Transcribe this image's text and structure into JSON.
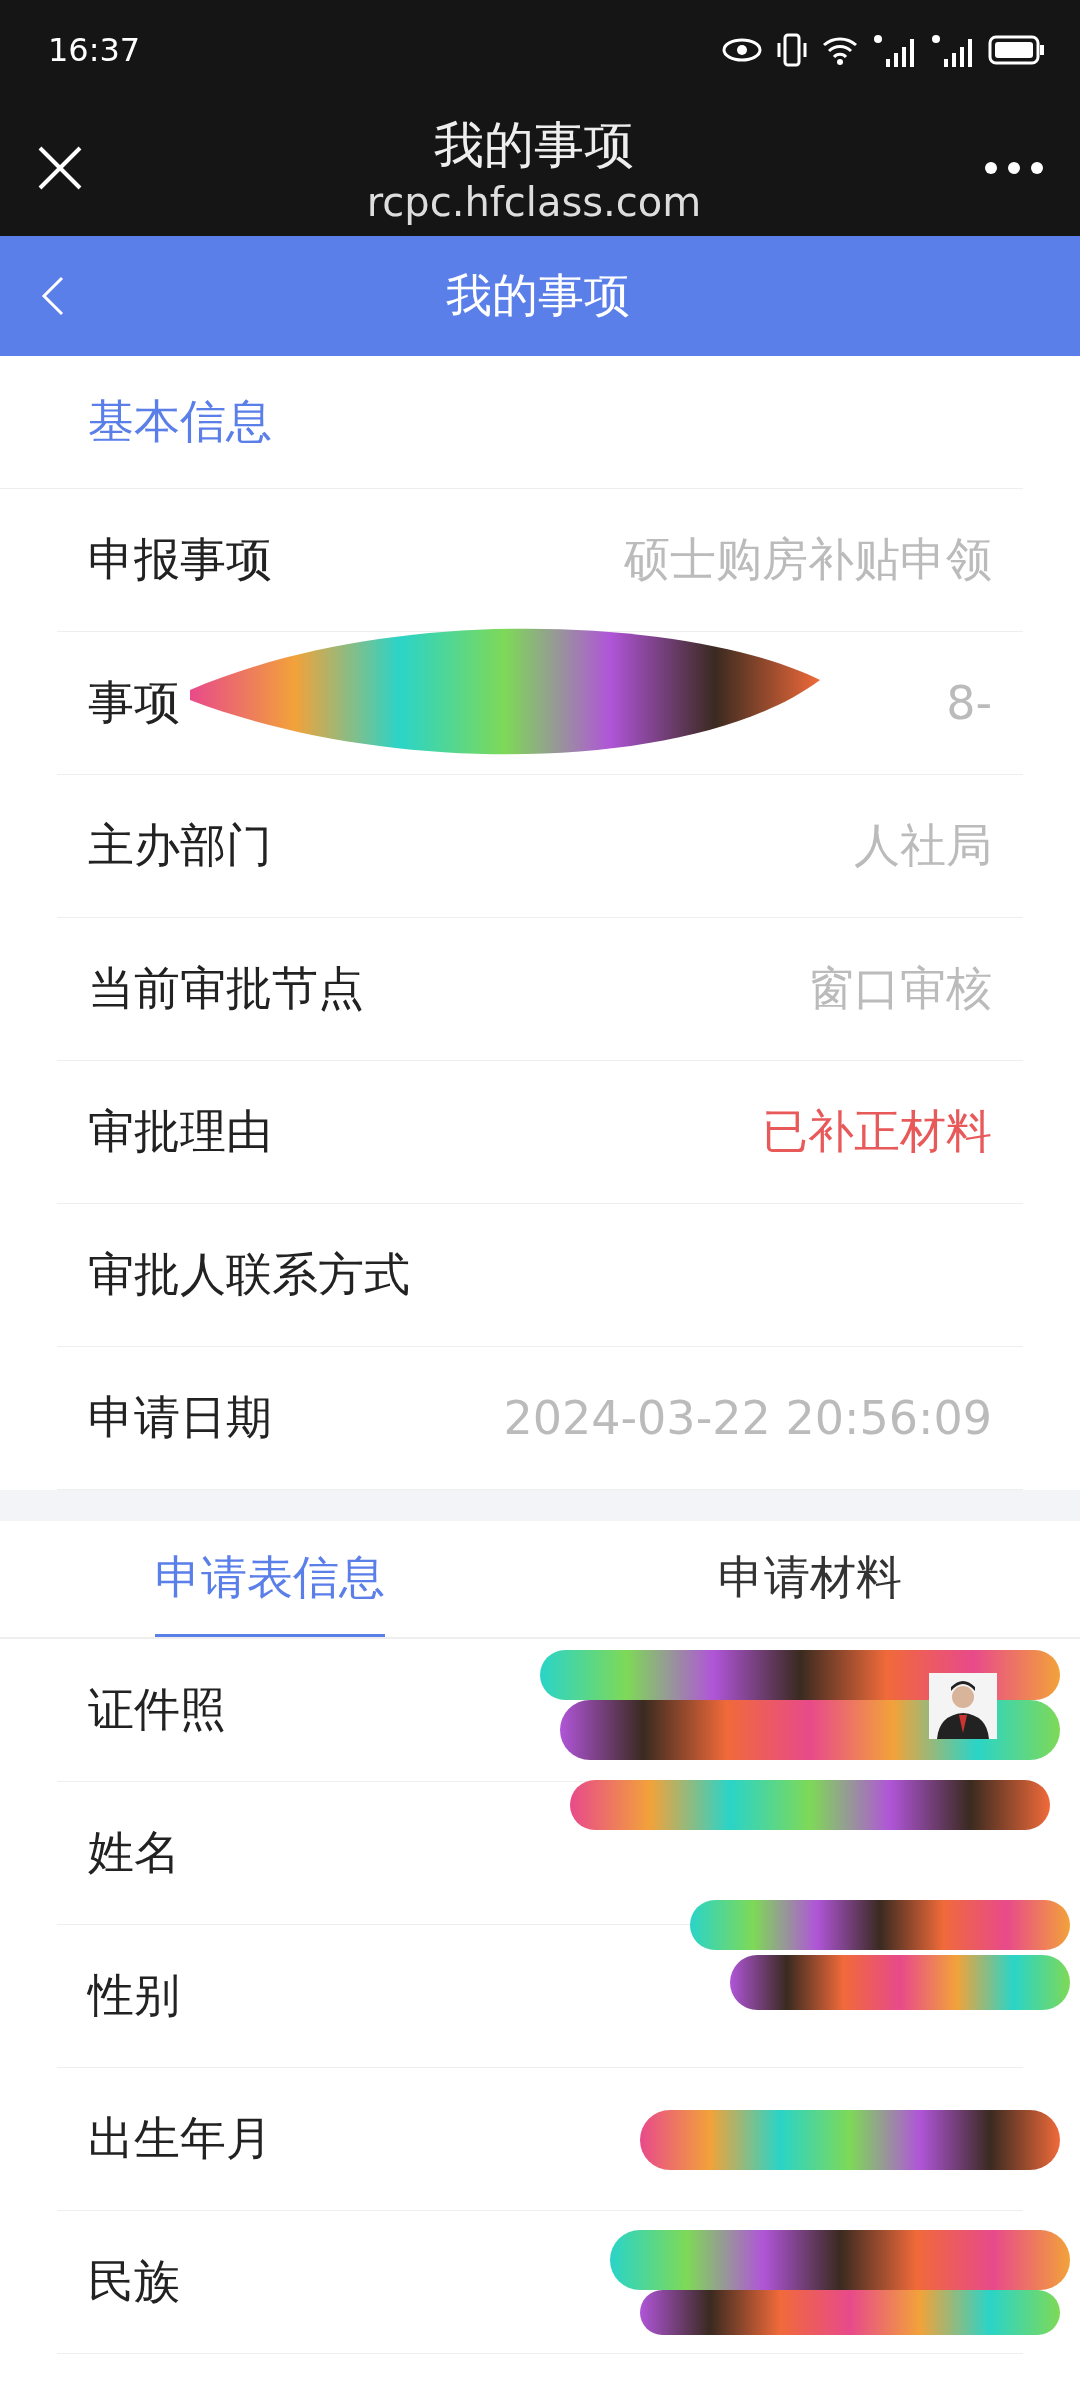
{
  "status_bar": {
    "time": "16:37"
  },
  "browser": {
    "title": "我的事项",
    "url": "rcpc.hfclass.com"
  },
  "header": {
    "title": "我的事项"
  },
  "basic_info": {
    "heading": "基本信息",
    "rows": [
      {
        "label": "申报事项",
        "value": "硕士购房补贴申领",
        "kind": "plain"
      },
      {
        "label": "事项",
        "value": "8-",
        "kind": "plain"
      },
      {
        "label": "主办部门",
        "value": "人社局",
        "kind": "plain"
      },
      {
        "label": "当前审批节点",
        "value": "窗口审核",
        "kind": "plain"
      },
      {
        "label": "审批理由",
        "value": "已补正材料",
        "kind": "alert"
      },
      {
        "label": "审批人联系方式"
      },
      {
        "label": "申请日期",
        "value": "2024-03-22 20:56:09",
        "kind": "plain"
      }
    ]
  },
  "tabs": [
    {
      "label": "申请表信息",
      "selected": true
    },
    {
      "label": "申请材料",
      "selected": false
    }
  ],
  "form_rows": [
    {
      "label": "证件照"
    },
    {
      "label": "姓名",
      "kind": "plain"
    },
    {
      "label": "性别",
      "kind": "plain"
    },
    {
      "label": "出生年月",
      "kind": "plain"
    },
    {
      "label": "民族",
      "kind": "plain"
    }
  ]
}
